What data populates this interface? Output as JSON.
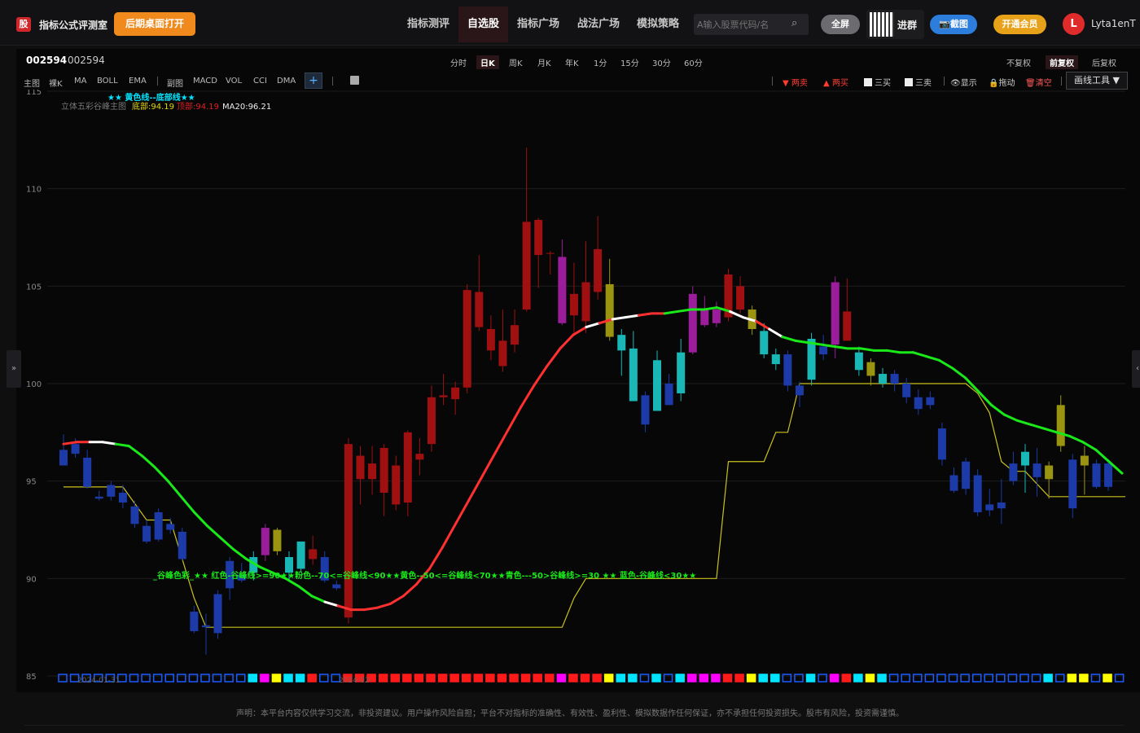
{
  "app": {
    "logo_char": "股",
    "title": "指标公式评测室",
    "open_desktop": "后期桌面打开"
  },
  "nav": [
    {
      "label": "指标测评",
      "active": false
    },
    {
      "label": "自选股",
      "active": true
    },
    {
      "label": "指标广场",
      "active": false
    },
    {
      "label": "战法广场",
      "active": false
    },
    {
      "label": "模拟策略",
      "active": false
    }
  ],
  "search": {
    "placeholder": "A输入股票代码/名"
  },
  "header_buttons": {
    "fullscreen": "全屏",
    "join_group": "进群",
    "screenshot": "📷截图",
    "vip": "开通会员"
  },
  "user": {
    "avatar_letter": "L",
    "name": "Lyta1enT"
  },
  "stock": {
    "code": "002594",
    "name": "002594"
  },
  "periods": [
    {
      "label": "分时",
      "active": false
    },
    {
      "label": "日K",
      "active": true
    },
    {
      "label": "周K",
      "active": false
    },
    {
      "label": "月K",
      "active": false
    },
    {
      "label": "年K",
      "active": false
    },
    {
      "label": "1分",
      "active": false
    },
    {
      "label": "15分",
      "active": false
    },
    {
      "label": "30分",
      "active": false
    },
    {
      "label": "60分",
      "active": false
    }
  ],
  "adjust": [
    {
      "label": "不复权",
      "active": false
    },
    {
      "label": "前复权",
      "active": true
    },
    {
      "label": "后复权",
      "active": false
    }
  ],
  "indicators_main": [
    "主图",
    "裸K",
    "MA",
    "BOLL",
    "EMA"
  ],
  "indicators_sub": [
    "副图",
    "MACD",
    "VOL",
    "CCI",
    "DMA"
  ],
  "add_indicator": "+",
  "tools": [
    {
      "label": "▼ 两卖",
      "color": "#ff3b30"
    },
    {
      "label": "▲ 两买",
      "color": "#ff3b30"
    },
    {
      "label": "三买",
      "color": "#ccc"
    },
    {
      "label": "三卖",
      "color": "#ccc"
    },
    {
      "label": "显示",
      "color": "#ccc"
    },
    {
      "label": "拖动",
      "color": "#ccc"
    },
    {
      "label": "清空",
      "color": "#ff5a5a"
    }
  ],
  "draw_tools": "画线工具 ▼",
  "side_handles": {
    "left": "»",
    "right": "‹"
  },
  "legend": {
    "line1": "★★ 黄色线--底部线★★",
    "line2_name": "立体五彩谷峰主图",
    "bottom_label": "底部:94.19",
    "top_label": "顶部:94.19",
    "ma_label": "MA20:96.21"
  },
  "annotation": "_谷峰色彩_★★ 红色-谷峰线>=90★★粉色--70<=谷峰线<90★★黄色--50<=谷峰线<70★★青色---50>谷峰线>=30 ★★ 蓝色-谷峰线<30★★",
  "date_labels": [
    "2024-01-31",
    "2024-02-"
  ],
  "disclaimer": "声明：本平台内容仅供学习交流，非投资建议。用户操作风险自担；平台不对指标的准确性、有效性、盈利性、模拟数据作任何保证，亦不承担任何投资损失。股市有风险，投资需谨慎。",
  "chart_data": {
    "type": "candlestick",
    "ylim": [
      85,
      115
    ],
    "yticks": [
      85,
      90,
      95,
      100,
      105,
      110,
      115
    ],
    "candles": [
      {
        "o": 96.6,
        "h": 97.4,
        "l": 96.0,
        "c": 95.8,
        "color": "#1c3aa8"
      },
      {
        "o": 96.9,
        "h": 97.2,
        "l": 96.2,
        "c": 96.4,
        "color": "#1c3aa8"
      },
      {
        "o": 96.2,
        "h": 96.6,
        "l": 94.6,
        "c": 94.7,
        "color": "#1c3aa8"
      },
      {
        "o": 94.2,
        "h": 94.5,
        "l": 94.0,
        "c": 94.1,
        "color": "#1c3aa8"
      },
      {
        "o": 94.8,
        "h": 95.0,
        "l": 94.0,
        "c": 94.2,
        "color": "#1c3aa8"
      },
      {
        "o": 94.4,
        "h": 94.8,
        "l": 93.6,
        "c": 93.9,
        "color": "#1c3aa8"
      },
      {
        "o": 93.7,
        "h": 94.0,
        "l": 92.6,
        "c": 92.8,
        "color": "#1c3aa8"
      },
      {
        "o": 92.7,
        "h": 93.0,
        "l": 91.8,
        "c": 91.9,
        "color": "#1c3aa8"
      },
      {
        "o": 93.4,
        "h": 93.6,
        "l": 91.9,
        "c": 92.0,
        "color": "#1c3aa8"
      },
      {
        "o": 92.8,
        "h": 93.1,
        "l": 92.3,
        "c": 92.5,
        "color": "#1c3aa8"
      },
      {
        "o": 92.4,
        "h": 92.6,
        "l": 90.9,
        "c": 91.0,
        "color": "#1c3aa8"
      },
      {
        "o": 88.3,
        "h": 88.6,
        "l": 87.2,
        "c": 87.3,
        "color": "#1c3aa8"
      },
      {
        "o": 87.5,
        "h": 88.2,
        "l": 86.1,
        "c": 87.6,
        "color": "#1c3aa8"
      },
      {
        "o": 89.2,
        "h": 89.4,
        "l": 86.9,
        "c": 87.2,
        "color": "#1c3aa8"
      },
      {
        "o": 89.5,
        "h": 91.1,
        "l": 88.9,
        "c": 90.9,
        "color": "#1c3aa8"
      },
      {
        "o": 90.2,
        "h": 90.8,
        "l": 89.8,
        "c": 89.9,
        "color": "#1c3aa8"
      },
      {
        "o": 90.3,
        "h": 91.4,
        "l": 89.9,
        "c": 91.1,
        "color": "#1ab7b7"
      },
      {
        "o": 91.2,
        "h": 92.8,
        "l": 90.9,
        "c": 92.6,
        "color": "#9b1d9b"
      },
      {
        "o": 92.5,
        "h": 92.6,
        "l": 91.2,
        "c": 91.4,
        "color": "#9a9410"
      },
      {
        "o": 90.3,
        "h": 91.4,
        "l": 89.9,
        "c": 91.1,
        "color": "#1ab7b7"
      },
      {
        "o": 91.9,
        "h": 91.7,
        "l": 90.3,
        "c": 90.5,
        "color": "#1ab7b7"
      },
      {
        "o": 91.5,
        "h": 92.2,
        "l": 90.7,
        "c": 91.0,
        "color": "#a01010"
      },
      {
        "o": 91.1,
        "h": 91.4,
        "l": 89.8,
        "c": 89.9,
        "color": "#1c3aa8"
      },
      {
        "o": 89.7,
        "h": 89.9,
        "l": 89.4,
        "c": 89.5,
        "color": "#1c3aa8"
      },
      {
        "o": 88.0,
        "h": 97.2,
        "l": 87.7,
        "c": 96.9,
        "color": "#a01010"
      },
      {
        "o": 95.1,
        "h": 96.8,
        "l": 93.8,
        "c": 96.3,
        "color": "#a01010"
      },
      {
        "o": 95.1,
        "h": 96.8,
        "l": 94.3,
        "c": 95.9,
        "color": "#a01010"
      },
      {
        "o": 94.4,
        "h": 96.9,
        "l": 93.2,
        "c": 96.7,
        "color": "#a01010"
      },
      {
        "o": 93.8,
        "h": 96.3,
        "l": 93.5,
        "c": 95.8,
        "color": "#a01010"
      },
      {
        "o": 93.9,
        "h": 97.6,
        "l": 93.2,
        "c": 97.5,
        "color": "#a01010"
      },
      {
        "o": 96.1,
        "h": 97.2,
        "l": 95.3,
        "c": 96.4,
        "color": "#a01010"
      },
      {
        "o": 96.9,
        "h": 99.9,
        "l": 96.5,
        "c": 99.3,
        "color": "#a01010"
      },
      {
        "o": 99.3,
        "h": 100.5,
        "l": 98.9,
        "c": 99.4,
        "color": "#a01010"
      },
      {
        "o": 99.2,
        "h": 100.1,
        "l": 98.4,
        "c": 99.8,
        "color": "#a01010"
      },
      {
        "o": 99.8,
        "h": 105.1,
        "l": 99.5,
        "c": 104.8,
        "color": "#a01010"
      },
      {
        "o": 102.9,
        "h": 106.6,
        "l": 102.7,
        "c": 104.7,
        "color": "#a01010"
      },
      {
        "o": 101.7,
        "h": 103.5,
        "l": 101.2,
        "c": 102.8,
        "color": "#a01010"
      },
      {
        "o": 100.9,
        "h": 103.8,
        "l": 100.6,
        "c": 102.2,
        "color": "#a01010"
      },
      {
        "o": 102.0,
        "h": 103.8,
        "l": 101.6,
        "c": 103.0,
        "color": "#a01010"
      },
      {
        "o": 103.8,
        "h": 112.1,
        "l": 103.7,
        "c": 108.3,
        "color": "#a01010"
      },
      {
        "o": 106.6,
        "h": 108.5,
        "l": 104.9,
        "c": 108.4,
        "color": "#a01010"
      },
      {
        "o": 106.7,
        "h": 106.8,
        "l": 105.6,
        "c": 106.7,
        "color": "#a01010"
      },
      {
        "o": 106.5,
        "h": 107.4,
        "l": 103.0,
        "c": 103.1,
        "color": "#9b1d9b"
      },
      {
        "o": 103.5,
        "h": 106.2,
        "l": 102.6,
        "c": 104.6,
        "color": "#a01010"
      },
      {
        "o": 103.2,
        "h": 107.3,
        "l": 102.6,
        "c": 105.2,
        "color": "#a01010"
      },
      {
        "o": 104.7,
        "h": 108.6,
        "l": 104.3,
        "c": 106.9,
        "color": "#a01010"
      },
      {
        "o": 105.1,
        "h": 106.4,
        "l": 102.2,
        "c": 102.4,
        "color": "#9a9410"
      },
      {
        "o": 102.5,
        "h": 102.8,
        "l": 100.4,
        "c": 101.7,
        "color": "#1ab7b7"
      },
      {
        "o": 101.8,
        "h": 102.7,
        "l": 99.2,
        "c": 99.1,
        "color": "#1ab7b7"
      },
      {
        "o": 99.4,
        "h": 99.6,
        "l": 97.5,
        "c": 97.9,
        "color": "#1c3aa8"
      },
      {
        "o": 101.2,
        "h": 101.7,
        "l": 98.8,
        "c": 98.6,
        "color": "#1ab7b7"
      },
      {
        "o": 100.0,
        "h": 100.5,
        "l": 98.9,
        "c": 98.9,
        "color": "#1c3aa8"
      },
      {
        "o": 101.6,
        "h": 102.3,
        "l": 99.1,
        "c": 99.5,
        "color": "#1ab7b7"
      },
      {
        "o": 104.6,
        "h": 105.0,
        "l": 101.5,
        "c": 101.6,
        "color": "#9b1d9b"
      },
      {
        "o": 103.8,
        "h": 104.5,
        "l": 102.9,
        "c": 103.0,
        "color": "#9b1d9b"
      },
      {
        "o": 103.8,
        "h": 104.2,
        "l": 102.9,
        "c": 103.1,
        "color": "#9b1d9b"
      },
      {
        "o": 105.6,
        "h": 105.9,
        "l": 103.2,
        "c": 103.4,
        "color": "#a01010"
      },
      {
        "o": 105.0,
        "h": 105.5,
        "l": 103.6,
        "c": 103.8,
        "color": "#a01010"
      },
      {
        "o": 103.8,
        "h": 104.0,
        "l": 102.5,
        "c": 102.8,
        "color": "#9a9410"
      },
      {
        "o": 102.7,
        "h": 103.1,
        "l": 101.3,
        "c": 101.5,
        "color": "#1ab7b7"
      },
      {
        "o": 101.5,
        "h": 101.8,
        "l": 100.7,
        "c": 101.0,
        "color": "#1ab7b7"
      },
      {
        "o": 101.5,
        "h": 101.7,
        "l": 99.6,
        "c": 99.9,
        "color": "#1c3aa8"
      },
      {
        "o": 99.9,
        "h": 100.1,
        "l": 98.8,
        "c": 99.4,
        "color": "#1c3aa8"
      },
      {
        "o": 102.3,
        "h": 102.6,
        "l": 99.9,
        "c": 100.2,
        "color": "#1ab7b7"
      },
      {
        "o": 101.9,
        "h": 102.5,
        "l": 101.2,
        "c": 101.5,
        "color": "#1c3aa8"
      },
      {
        "o": 102.0,
        "h": 105.5,
        "l": 101.3,
        "c": 105.2,
        "color": "#9b1d9b"
      },
      {
        "o": 103.7,
        "h": 105.4,
        "l": 102.3,
        "c": 102.2,
        "color": "#a01010"
      },
      {
        "o": 101.6,
        "h": 101.9,
        "l": 100.4,
        "c": 100.7,
        "color": "#1ab7b7"
      },
      {
        "o": 101.1,
        "h": 101.3,
        "l": 99.9,
        "c": 100.4,
        "color": "#9a9410"
      },
      {
        "o": 100.5,
        "h": 100.8,
        "l": 99.8,
        "c": 100.0,
        "color": "#1ab7b7"
      },
      {
        "o": 100.5,
        "h": 100.7,
        "l": 99.6,
        "c": 100.0,
        "color": "#1c3aa8"
      },
      {
        "o": 100.0,
        "h": 100.3,
        "l": 99.0,
        "c": 99.3,
        "color": "#1c3aa8"
      },
      {
        "o": 99.3,
        "h": 99.7,
        "l": 98.4,
        "c": 98.7,
        "color": "#1c3aa8"
      },
      {
        "o": 99.3,
        "h": 99.6,
        "l": 98.7,
        "c": 98.9,
        "color": "#1c3aa8"
      },
      {
        "o": 97.7,
        "h": 98.0,
        "l": 95.8,
        "c": 96.1,
        "color": "#1c3aa8"
      },
      {
        "o": 95.3,
        "h": 95.7,
        "l": 94.4,
        "c": 94.5,
        "color": "#1c3aa8"
      },
      {
        "o": 96.0,
        "h": 96.2,
        "l": 94.3,
        "c": 94.6,
        "color": "#1c3aa8"
      },
      {
        "o": 95.3,
        "h": 95.6,
        "l": 93.2,
        "c": 93.4,
        "color": "#1c3aa8"
      },
      {
        "o": 93.8,
        "h": 94.6,
        "l": 93.2,
        "c": 93.5,
        "color": "#1c3aa8"
      },
      {
        "o": 93.9,
        "h": 95.1,
        "l": 92.8,
        "c": 93.6,
        "color": "#1c3aa8"
      },
      {
        "o": 95.9,
        "h": 96.5,
        "l": 94.8,
        "c": 95.0,
        "color": "#1c3aa8"
      },
      {
        "o": 96.5,
        "h": 96.9,
        "l": 94.4,
        "c": 95.8,
        "color": "#1ab7b7"
      },
      {
        "o": 95.9,
        "h": 96.7,
        "l": 94.2,
        "c": 95.2,
        "color": "#1c3aa8"
      },
      {
        "o": 95.1,
        "h": 96.0,
        "l": 94.1,
        "c": 95.8,
        "color": "#9a9410"
      },
      {
        "o": 96.8,
        "h": 99.4,
        "l": 96.5,
        "c": 98.9,
        "color": "#9a9410"
      },
      {
        "o": 96.1,
        "h": 96.4,
        "l": 93.1,
        "c": 93.6,
        "color": "#1c3aa8"
      },
      {
        "o": 96.3,
        "h": 96.8,
        "l": 94.3,
        "c": 95.8,
        "color": "#9a9410"
      },
      {
        "o": 95.9,
        "h": 96.1,
        "l": 94.6,
        "c": 94.7,
        "color": "#1c3aa8"
      },
      {
        "o": 95.9,
        "h": 96.1,
        "l": 94.5,
        "c": 94.7,
        "color": "#1c3aa8"
      }
    ],
    "ma_segments_note": "color codes along MA20 line",
    "ma20": [
      96.9,
      97.0,
      97.0,
      97.0,
      96.9,
      96.8,
      96.3,
      95.7,
      95.0,
      94.2,
      93.4,
      92.7,
      92.1,
      91.5,
      91.0,
      90.6,
      90.3,
      90.0,
      89.6,
      89.1,
      88.8,
      88.6,
      88.4,
      88.4,
      88.5,
      88.7,
      89.1,
      89.7,
      90.5,
      91.6,
      92.8,
      94.0,
      95.2,
      96.4,
      97.6,
      98.8,
      99.9,
      100.9,
      101.8,
      102.5,
      102.9,
      103.1,
      103.3,
      103.4,
      103.5,
      103.6,
      103.6,
      103.7,
      103.8,
      103.8,
      103.9,
      103.7,
      103.4,
      103.2,
      102.8,
      102.4,
      102.2,
      102.1,
      102.0,
      101.9,
      101.8,
      101.8,
      101.7,
      101.7,
      101.6,
      101.6,
      101.4,
      101.2,
      100.8,
      100.3,
      99.6,
      98.9,
      98.4,
      98.1,
      97.9,
      97.7,
      97.5,
      97.3,
      97.0,
      96.6,
      96.0,
      95.4
    ],
    "ma_colors": [
      "#ff3030",
      "#ff3030",
      "#ffffff",
      "#ffffff",
      "#19e819",
      "#19e819",
      "#19e819",
      "#19e819",
      "#19e819",
      "#19e819",
      "#19e819",
      "#19e819",
      "#19e819",
      "#19e819",
      "#19e819",
      "#19e819",
      "#19e819",
      "#19e819",
      "#19e819",
      "#19e819",
      "#ffffff",
      "#ff3030",
      "#ff3030",
      "#ff3030",
      "#ff3030",
      "#ff3030",
      "#ff3030",
      "#ff3030",
      "#ff3030",
      "#ff3030",
      "#ff3030",
      "#ff3030",
      "#ff3030",
      "#ff3030",
      "#ff3030",
      "#ff3030",
      "#ff3030",
      "#ff3030",
      "#ff3030",
      "#ff3030",
      "#ffffff",
      "#ff3030",
      "#ffffff",
      "#ffffff",
      "#ff3030",
      "#ff3030",
      "#19e819",
      "#19e819",
      "#19e819",
      "#19e819",
      "#19e819",
      "#ffffff",
      "#ffffff",
      "#ff3030",
      "#ffffff",
      "#19e819",
      "#19e819",
      "#19e819",
      "#19e819",
      "#19e819",
      "#19e819",
      "#19e819",
      "#19e819",
      "#19e819",
      "#19e819",
      "#19e819",
      "#19e819",
      "#19e819",
      "#19e819",
      "#19e819",
      "#19e819",
      "#19e819",
      "#19e819",
      "#19e819",
      "#19e819",
      "#19e819",
      "#19e819",
      "#19e819",
      "#19e819",
      "#19e819",
      "#19e819",
      "#ff3030"
    ],
    "support_line": [
      [
        0,
        94.7
      ],
      [
        5,
        94.7
      ],
      [
        7,
        93.0
      ],
      [
        9,
        93.0
      ],
      [
        11,
        89.0
      ],
      [
        12,
        87.5
      ],
      [
        14,
        87.5
      ],
      [
        42,
        87.5
      ],
      [
        43,
        89.0
      ],
      [
        44,
        90.0
      ],
      [
        55,
        90.0
      ],
      [
        56,
        96.0
      ],
      [
        59,
        96.0
      ],
      [
        60,
        97.5
      ],
      [
        61,
        97.5
      ],
      [
        62,
        100.0
      ],
      [
        76,
        100.0
      ],
      [
        77,
        99.5
      ],
      [
        78,
        98.5
      ],
      [
        79,
        96.0
      ],
      [
        80,
        95.5
      ],
      [
        81,
        95.5
      ],
      [
        83,
        94.2
      ],
      [
        90,
        94.2
      ]
    ],
    "bottom_squares": [
      "#1c5cff",
      "#1c5cff",
      "#1c5cff",
      "#1c5cff",
      "#1c5cff",
      "#1c5cff",
      "#1c5cff",
      "#1c5cff",
      "#1c5cff",
      "#1c5cff",
      "#1c5cff",
      "#1c5cff",
      "#1c5cff",
      "#1c5cff",
      "#1c5cff",
      "#1c5cff",
      "#00e5ff",
      "#ff00ff",
      "#ffff00",
      "#00e5ff",
      "#00e5ff",
      "#ff1a1a",
      "#1c5cff",
      "#1c5cff",
      "#ff1a1a",
      "#ff1a1a",
      "#ff1a1a",
      "#ff1a1a",
      "#ff1a1a",
      "#ff1a1a",
      "#ff1a1a",
      "#ff1a1a",
      "#ff1a1a",
      "#ff1a1a",
      "#ff1a1a",
      "#ff1a1a",
      "#ff1a1a",
      "#ff1a1a",
      "#ff1a1a",
      "#ff1a1a",
      "#ff1a1a",
      "#ff1a1a",
      "#ff00ff",
      "#ff1a1a",
      "#ff1a1a",
      "#ff1a1a",
      "#ffff00",
      "#00e5ff",
      "#00e5ff",
      "#1c5cff",
      "#00e5ff",
      "#1c5cff",
      "#00e5ff",
      "#ff00ff",
      "#ff00ff",
      "#ff00ff",
      "#ff1a1a",
      "#ff1a1a",
      "#ffff00",
      "#00e5ff",
      "#00e5ff",
      "#1c5cff",
      "#1c5cff",
      "#00e5ff",
      "#1c5cff",
      "#ff00ff",
      "#ff1a1a",
      "#00e5ff",
      "#ffff00",
      "#00e5ff",
      "#1c5cff",
      "#1c5cff",
      "#1c5cff",
      "#1c5cff",
      "#1c5cff",
      "#1c5cff",
      "#1c5cff",
      "#1c5cff",
      "#1c5cff",
      "#1c5cff",
      "#1c5cff",
      "#1c5cff",
      "#1c5cff",
      "#00e5ff",
      "#1c5cff",
      "#ffff00",
      "#ffff00",
      "#1c5cff",
      "#ffff00",
      "#1c5cff",
      "#1c5cff"
    ]
  }
}
